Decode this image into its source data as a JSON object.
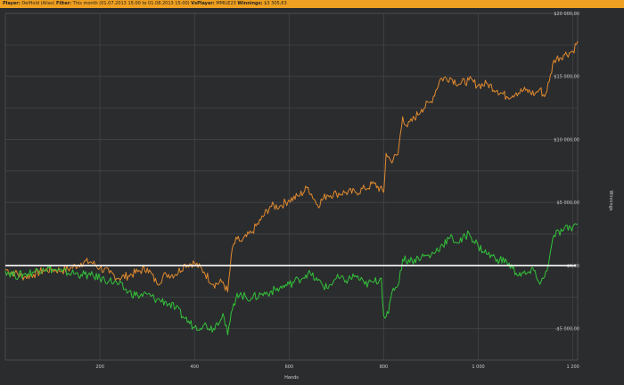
{
  "header": {
    "player_label": "Player:",
    "player_value": "DelHold (Alias)",
    "filter_label": "Filter:",
    "filter_value": "This month (01.07.2013 15:00 to 01.08.2013 15:00)",
    "vs_label": "VsPlayer:",
    "vs_value": "MMILE23",
    "winnings_label": "Winnings:",
    "winnings_value": "$3 305,63"
  },
  "colors": {
    "background": "#2b2c2e",
    "grid": "#424448",
    "header_bar": "#f0a020",
    "series_orange": "#e08a2e",
    "series_green": "#33c23a",
    "zero_line": "#ffffff"
  },
  "chart_data": {
    "type": "line",
    "xlabel": "Hands",
    "ylabel": "Winnings",
    "xlim": [
      0,
      1210
    ],
    "ylim": [
      -7500,
      20000
    ],
    "x_ticks": [
      200,
      400,
      600,
      800,
      1000,
      1200
    ],
    "x_tick_labels": [
      "200",
      "400",
      "600",
      "800",
      "1 000",
      "1 200"
    ],
    "y_ticks": [
      -5000,
      0,
      5000,
      10000,
      15000,
      20000
    ],
    "y_tick_labels": [
      "-$5 000,00",
      "$0,00",
      "$5 000,00",
      "$10 000,00",
      "$15 000,00",
      "$20 000,00"
    ],
    "grid": true,
    "zero_line": true,
    "series": [
      {
        "color": "#e08a2e",
        "x": [
          0,
          20,
          40,
          60,
          80,
          100,
          120,
          140,
          160,
          180,
          200,
          220,
          240,
          260,
          280,
          300,
          320,
          340,
          360,
          380,
          400,
          420,
          440,
          460,
          470,
          480,
          490,
          500,
          520,
          540,
          560,
          580,
          600,
          620,
          640,
          660,
          680,
          700,
          720,
          740,
          760,
          780,
          800,
          805,
          815,
          830,
          840,
          850,
          880,
          900,
          920,
          940,
          960,
          980,
          1000,
          1020,
          1040,
          1060,
          1080,
          1100,
          1120,
          1130,
          1140,
          1150,
          1160,
          1180,
          1200,
          1210
        ],
        "y": [
          -300,
          -600,
          -900,
          -700,
          -400,
          -300,
          -400,
          -200,
          200,
          300,
          -200,
          -600,
          -1000,
          -800,
          -500,
          -200,
          -1400,
          -700,
          -700,
          100,
          200,
          -500,
          -1500,
          -1300,
          -2100,
          1400,
          2100,
          1900,
          2600,
          3600,
          4700,
          4700,
          5200,
          5500,
          6200,
          4800,
          5600,
          5700,
          5800,
          5800,
          6100,
          6500,
          5800,
          8900,
          8300,
          8800,
          11800,
          11000,
          12400,
          13000,
          14800,
          14900,
          14400,
          14700,
          14300,
          14400,
          13900,
          13400,
          13700,
          13900,
          13600,
          14000,
          13400,
          14600,
          16300,
          16700,
          17000,
          17800
        ]
      },
      {
        "color": "#33c23a",
        "x": [
          0,
          20,
          40,
          60,
          80,
          100,
          120,
          140,
          160,
          180,
          200,
          220,
          240,
          260,
          280,
          300,
          320,
          340,
          360,
          380,
          400,
          420,
          440,
          460,
          470,
          480,
          490,
          500,
          520,
          540,
          560,
          580,
          600,
          620,
          640,
          660,
          680,
          700,
          720,
          740,
          760,
          780,
          795,
          800,
          810,
          820,
          830,
          840,
          860,
          880,
          900,
          920,
          940,
          960,
          980,
          1000,
          1020,
          1040,
          1060,
          1080,
          1100,
          1120,
          1130,
          1140,
          1150,
          1160,
          1180,
          1200,
          1210
        ],
        "y": [
          -400,
          -800,
          -700,
          -500,
          -200,
          -300,
          -500,
          -600,
          -700,
          -800,
          -1000,
          -1200,
          -1500,
          -2100,
          -2400,
          -2300,
          -2700,
          -2900,
          -3400,
          -4200,
          -4900,
          -4700,
          -5000,
          -3800,
          -5500,
          -3500,
          -2200,
          -2400,
          -2600,
          -2300,
          -2100,
          -1800,
          -1500,
          -1100,
          -600,
          -1200,
          -1800,
          -1000,
          -1200,
          -800,
          -1500,
          -1300,
          -1000,
          -4000,
          -3800,
          -1800,
          -1600,
          500,
          400,
          700,
          800,
          1500,
          2200,
          1800,
          2600,
          1500,
          900,
          500,
          300,
          -600,
          -700,
          -400,
          -1500,
          -900,
          500,
          2400,
          2800,
          3100,
          3300
        ]
      }
    ]
  }
}
